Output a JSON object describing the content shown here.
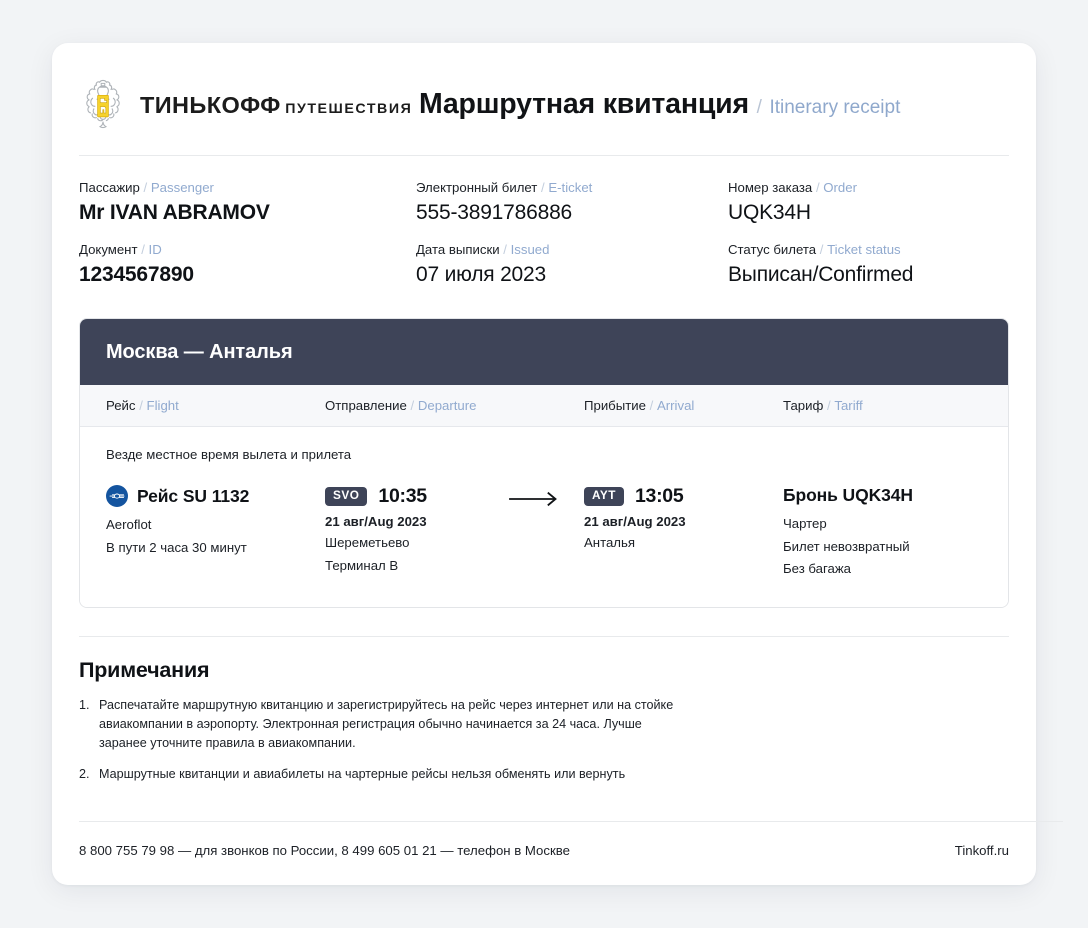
{
  "brand": {
    "emblem_icon": "tinkoff-shield-icon",
    "line1": "ТИНЬКОФФ",
    "line2": "ПУТЕШЕСТВИЯ",
    "emblem_gold": "#f6d22c",
    "emblem_outline": "#aeb3b8"
  },
  "header": {
    "title_ru": "Маршрутная квитанция",
    "slash": "/",
    "title_en": "Itinerary receipt"
  },
  "info": [
    {
      "label_ru": "Пассажир",
      "label_en": "Passenger",
      "value": "Mr IVAN ABRAMOV",
      "bold": true
    },
    {
      "label_ru": "Электронный билет",
      "label_en": "E-ticket",
      "value": "555-3891786886",
      "bold": false
    },
    {
      "label_ru": "Номер заказа",
      "label_en": "Order",
      "value": "UQK34H",
      "bold": false
    },
    {
      "label_ru": "Документ",
      "label_en": "ID",
      "value": "1234567890",
      "bold": true
    },
    {
      "label_ru": "Дата выписки",
      "label_en": "Issued",
      "value": "07 июля 2023",
      "bold": false
    },
    {
      "label_ru": "Статус билета",
      "label_en": "Ticket status",
      "value": "Выписан/Confirmed",
      "bold": false
    }
  ],
  "flight_card": {
    "header_bg": "#3e4458",
    "route": "Москва — Анталья",
    "columns": [
      {
        "ru": "Рейс",
        "en": "Flight"
      },
      {
        "ru": "Отправление",
        "en": "Departure"
      },
      {
        "ru": "Прибытие",
        "en": "Arrival"
      },
      {
        "ru": "Тариф",
        "en": "Tariff"
      }
    ],
    "local_time_note": "Везде местное время вылета и прилета",
    "segment": {
      "airline_logo_icon": "aeroflot-logo-icon",
      "airline_logo_color": "#14549f",
      "flight_number": "Рейс SU 1132",
      "airline_name": "Aeroflot",
      "duration": "В пути 2 часа 30 минут",
      "departure": {
        "iata": "SVO",
        "time": "10:35",
        "date": "21 авг/Aug 2023",
        "airport": "Шереметьево",
        "terminal": "Терминал B"
      },
      "arrow_icon": "arrow-right-icon",
      "arrival": {
        "iata": "AYT",
        "time": "13:05",
        "date": "21 авг/Aug 2023",
        "airport": "Анталья"
      },
      "tariff": {
        "booking": "Бронь UQK34H",
        "lines": [
          "Чартер",
          "Билет невозвратный",
          "Без багажа"
        ]
      }
    }
  },
  "notes": {
    "title": "Примечания",
    "items": [
      {
        "num": "1.",
        "text": "Распечатайте маршрутную квитанцию и зарегистрируйтесь на рейс через интернет или на стойке авиакомпании в аэропорту. Электронная регистрация обычно начинается за 24 часа. Лучше заранее уточните правила в авиакомпании."
      },
      {
        "num": "2.",
        "text": "Маршрутные квитанции и авиабилеты на чартерные рейсы нельзя обменять или вернуть"
      }
    ]
  },
  "footer": {
    "phones": "8 800 755 79 98 — для звонков по России, 8 499 605 01 21 — телефон в Москве",
    "site": "Tinkoff.ru"
  }
}
